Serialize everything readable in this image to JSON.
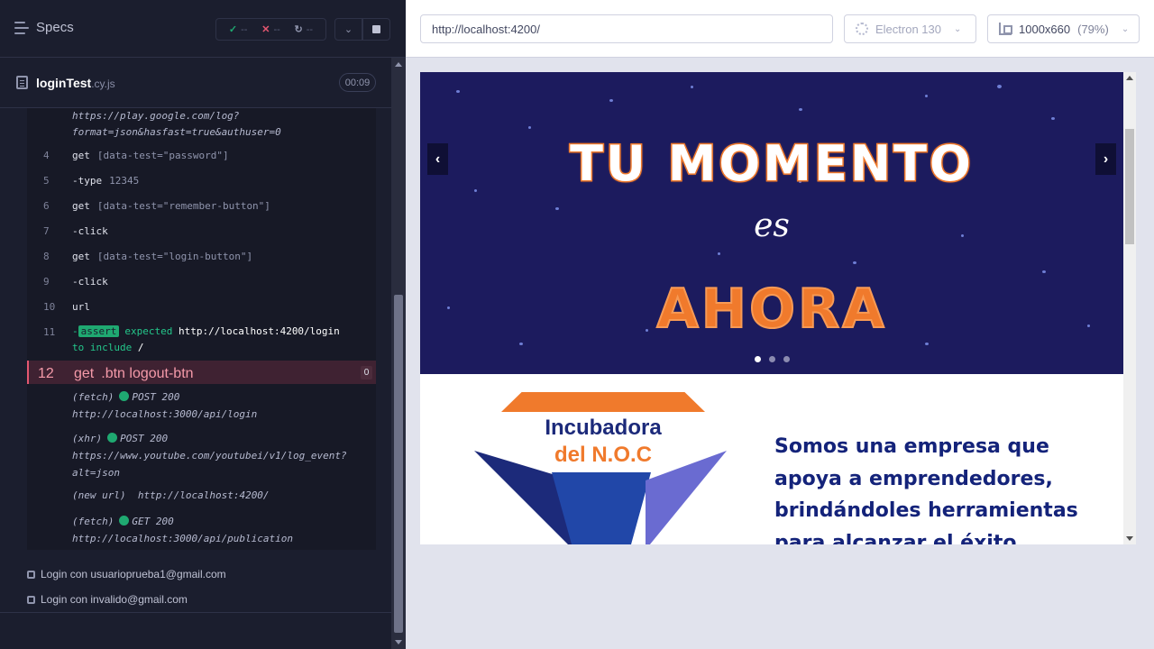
{
  "runner": {
    "specs_label": "Specs",
    "stats": {
      "passed": "--",
      "failed": "--",
      "pending": "--"
    },
    "file": {
      "name": "loginTest",
      "ext": ".cy.js",
      "duration": "00:09"
    },
    "commands": [
      {
        "num": "",
        "text": "https://play.google.com/log?\nformat=json&hasfast=true&authuser=0"
      },
      {
        "num": "4",
        "name": "get",
        "arg": "[data-test=\"password\"]"
      },
      {
        "num": "5",
        "name": "-type",
        "arg": "12345"
      },
      {
        "num": "6",
        "name": "get",
        "arg": "[data-test=\"remember-button\"]"
      },
      {
        "num": "7",
        "name": "-click",
        "arg": ""
      },
      {
        "num": "8",
        "name": "get",
        "arg": "[data-test=\"login-button\"]"
      },
      {
        "num": "9",
        "name": "-click",
        "arg": ""
      },
      {
        "num": "10",
        "name": "url",
        "arg": ""
      },
      {
        "num": "11",
        "badge": "assert",
        "expected": "expected",
        "value": "http://localhost:4200/login",
        "tail": "to include",
        "tail_value": "/"
      },
      {
        "num": "12",
        "name": "get",
        "arg": ".btn logout-btn",
        "count": "0"
      }
    ],
    "requests": [
      {
        "type": "(fetch)",
        "method": "POST 200",
        "url": "http://localhost:3000/api/login"
      },
      {
        "type": "(xhr)",
        "method": "POST 200",
        "url": "https://www.youtube.com/youtubei/v1/log_event?\nalt=json"
      },
      {
        "type": "(new url)",
        "url": "http://localhost:4200/"
      },
      {
        "type": "(fetch)",
        "method": "GET 200",
        "url": "http://localhost:3000/api/publication"
      }
    ],
    "tests": [
      "Login con usuarioprueba1@gmail.com",
      "Login con invalido@gmail.com"
    ]
  },
  "toolbar": {
    "url": "http://localhost:4200/",
    "browser": "Electron 130",
    "viewport": "1000x660",
    "zoom": "(79%)"
  },
  "page": {
    "banner": {
      "line1": "TU MOMENTO",
      "line2": "es",
      "line3": "AHORA"
    },
    "logo": {
      "title": "Incubadora",
      "subtitle": "del N.O.C"
    },
    "tagline": "Somos una empresa que apoya a emprendedores, brindándoles herramientas para alcanzar el éxito"
  },
  "colors": {
    "accent_orange": "#f07a2c",
    "banner_bg": "#1c1b5e",
    "pass_green": "#1fa971",
    "fail_red": "#e45770"
  }
}
